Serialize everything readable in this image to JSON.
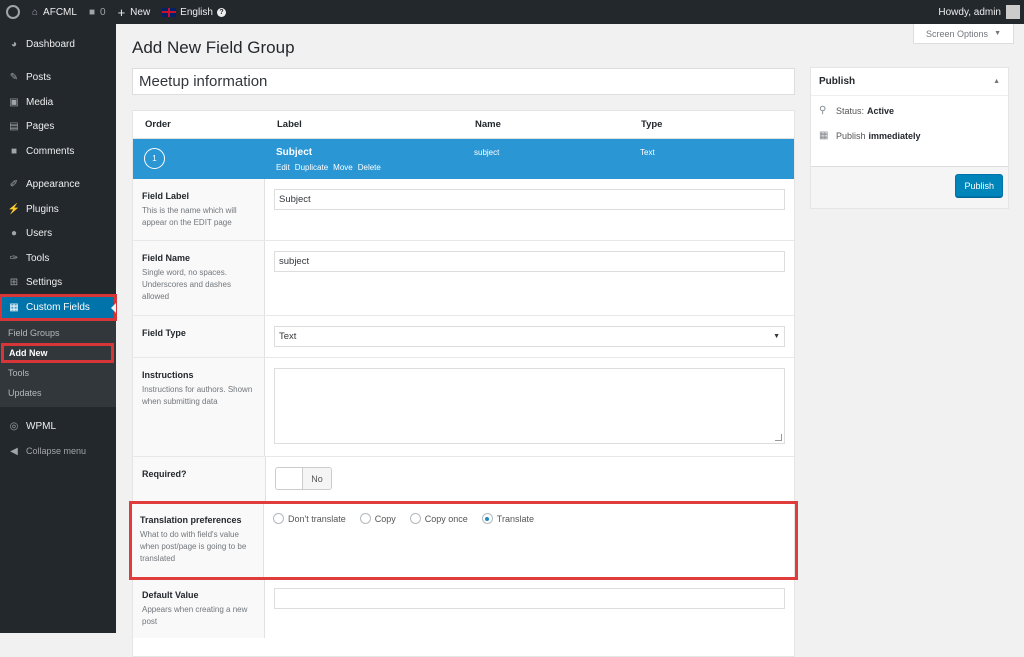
{
  "adminbar": {
    "site_name": "AFCML",
    "comments_count": "0",
    "new_label": "New",
    "language": "English",
    "howdy": "Howdy, admin"
  },
  "sidebar": {
    "items": [
      {
        "label": "Dashboard",
        "icon": "dashboard-icon"
      },
      {
        "label": "Posts",
        "icon": "pin-icon"
      },
      {
        "label": "Media",
        "icon": "media-icon"
      },
      {
        "label": "Pages",
        "icon": "pages-icon"
      },
      {
        "label": "Comments",
        "icon": "comment-icon"
      },
      {
        "label": "Appearance",
        "icon": "brush-icon"
      },
      {
        "label": "Plugins",
        "icon": "plugin-icon"
      },
      {
        "label": "Users",
        "icon": "users-icon"
      },
      {
        "label": "Tools",
        "icon": "wrench-icon"
      },
      {
        "label": "Settings",
        "icon": "settings-icon"
      },
      {
        "label": "Custom Fields",
        "icon": "custom-fields-icon"
      }
    ],
    "submenu": [
      "Field Groups",
      "Add New",
      "Tools",
      "Updates"
    ],
    "wpml": "WPML",
    "collapse": "Collapse menu"
  },
  "header": {
    "screen_options": "Screen Options",
    "title": "Add New Field Group",
    "group_title": "Meetup information"
  },
  "fields": {
    "columns": [
      "Order",
      "Label",
      "Name",
      "Type"
    ],
    "row": {
      "order": "1",
      "label": "Subject",
      "name": "subject",
      "type": "Text",
      "actions": [
        "Edit",
        "Duplicate",
        "Move",
        "Delete"
      ]
    },
    "settings": {
      "field_label": {
        "title": "Field Label",
        "desc": "This is the name which will appear on the EDIT page",
        "value": "Subject"
      },
      "field_name": {
        "title": "Field Name",
        "desc": "Single word, no spaces. Underscores and dashes allowed",
        "value": "subject"
      },
      "field_type": {
        "title": "Field Type",
        "value": "Text"
      },
      "instructions": {
        "title": "Instructions",
        "desc": "Instructions for authors. Shown when submitting data"
      },
      "required": {
        "title": "Required?",
        "value": "No"
      },
      "translation": {
        "title": "Translation preferences",
        "desc": "What to do with field's value when post/page is going to be translated",
        "options": [
          "Don't translate",
          "Copy",
          "Copy once",
          "Translate"
        ],
        "selected": "Translate"
      },
      "default_value": {
        "title": "Default Value",
        "desc": "Appears when creating a new post"
      }
    }
  },
  "publish": {
    "title": "Publish",
    "status_label": "Status:",
    "status_value": "Active",
    "publish_label": "Publish",
    "publish_value": "immediately",
    "button": "Publish"
  },
  "colors": {
    "accent": "#0073aa",
    "row": "#2a96d4",
    "highlight": "#e03c3c"
  }
}
